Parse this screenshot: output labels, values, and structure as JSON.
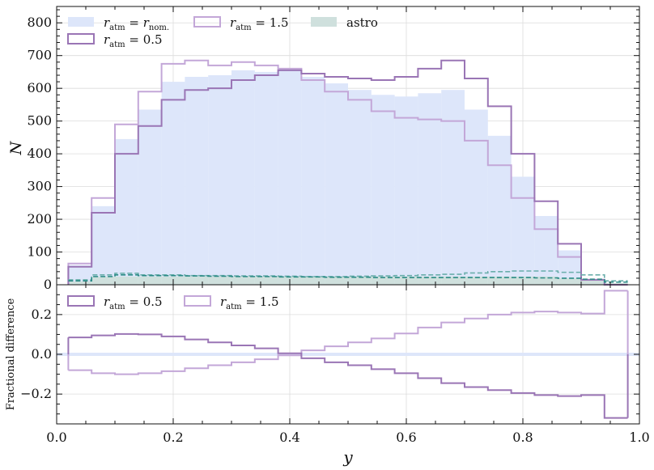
{
  "colors": {
    "nominal_fill": "#dde6fa",
    "r05": "#9a75b5",
    "r15": "#c3a7d8",
    "astro_fill": "#cfe0dd",
    "astro_dash_a": "#6aaeab",
    "astro_dash_b": "#2a8a85",
    "grid": "#dcdcdc"
  },
  "chart_data": [
    {
      "type": "bar",
      "panel": "top",
      "xlim": [
        0.0,
        1.0
      ],
      "ylim": [
        0,
        850
      ],
      "ylabel": "N",
      "xlabel": "",
      "grid": true,
      "legend_placement": "top-left",
      "bin_edges": [
        0.02,
        0.06,
        0.1,
        0.14,
        0.18,
        0.22,
        0.26,
        0.3,
        0.34,
        0.38,
        0.42,
        0.46,
        0.5,
        0.54,
        0.58,
        0.62,
        0.66,
        0.7,
        0.74,
        0.78,
        0.82,
        0.86,
        0.9,
        0.94,
        0.98
      ],
      "y_ticks": [
        "0",
        "100",
        "200",
        "300",
        "400",
        "500",
        "600",
        "700",
        "800"
      ],
      "series": [
        {
          "name": "r_atm = r_nom.",
          "style": "filled",
          "values": [
            60,
            240,
            445,
            535,
            620,
            635,
            640,
            655,
            650,
            660,
            635,
            615,
            595,
            580,
            575,
            585,
            595,
            535,
            455,
            330,
            210,
            105,
            15,
            0
          ]
        },
        {
          "name": "r_atm = 0.5",
          "style": "step",
          "values": [
            55,
            220,
            400,
            485,
            565,
            595,
            600,
            625,
            640,
            655,
            645,
            635,
            630,
            625,
            635,
            660,
            685,
            630,
            545,
            400,
            255,
            125,
            15,
            0
          ]
        },
        {
          "name": "r_atm = 1.5",
          "style": "step",
          "values": [
            65,
            265,
            490,
            590,
            675,
            685,
            670,
            680,
            670,
            660,
            625,
            590,
            565,
            530,
            510,
            505,
            500,
            440,
            365,
            265,
            170,
            85,
            15,
            0
          ]
        },
        {
          "name": "astro",
          "style": "filled",
          "values": [
            10,
            25,
            25,
            25,
            25,
            25,
            25,
            25,
            25,
            25,
            25,
            25,
            25,
            25,
            25,
            25,
            25,
            25,
            25,
            25,
            25,
            20,
            15,
            5
          ]
        },
        {
          "name": "",
          "style": "dashed-a",
          "values": [
            15,
            30,
            35,
            30,
            30,
            28,
            28,
            27,
            27,
            26,
            25,
            25,
            26,
            27,
            28,
            30,
            32,
            36,
            40,
            42,
            42,
            38,
            30,
            12
          ]
        },
        {
          "name": "",
          "style": "dashed-b",
          "values": [
            12,
            25,
            30,
            28,
            28,
            27,
            26,
            25,
            25,
            24,
            24,
            23,
            23,
            22,
            22,
            22,
            22,
            22,
            22,
            22,
            21,
            20,
            17,
            8
          ]
        }
      ],
      "legend": [
        {
          "label": "r_atm = r_nom.",
          "series": 0
        },
        {
          "label": "r_atm = 0.5",
          "series": 1
        },
        {
          "label": "r_atm = 1.5",
          "series": 2
        },
        {
          "label": "astro",
          "series": 3
        }
      ]
    },
    {
      "type": "bar",
      "panel": "bottom",
      "xlim": [
        0.0,
        1.0
      ],
      "ylim": [
        -0.35,
        0.35
      ],
      "ylabel": "Fractional difference",
      "xlabel": "y",
      "grid": true,
      "legend_placement": "top-left",
      "bin_edges": [
        0.02,
        0.06,
        0.1,
        0.14,
        0.18,
        0.22,
        0.26,
        0.3,
        0.34,
        0.38,
        0.42,
        0.46,
        0.5,
        0.54,
        0.58,
        0.62,
        0.66,
        0.7,
        0.74,
        0.78,
        0.82,
        0.86,
        0.9,
        0.94,
        0.98
      ],
      "x_ticks": [
        "0.0",
        "0.2",
        "0.4",
        "0.6",
        "0.8",
        "1.0"
      ],
      "y_ticks": [
        "−0.2",
        "0.0",
        "0.2"
      ],
      "series": [
        {
          "name": "r_atm = 0.5",
          "style": "step",
          "values": [
            0.085,
            0.095,
            0.102,
            0.1,
            0.09,
            0.075,
            0.06,
            0.045,
            0.03,
            0.005,
            -0.02,
            -0.04,
            -0.055,
            -0.075,
            -0.095,
            -0.12,
            -0.145,
            -0.165,
            -0.18,
            -0.195,
            -0.205,
            -0.21,
            -0.205,
            -0.32
          ]
        },
        {
          "name": "r_atm = 1.5",
          "style": "step",
          "values": [
            -0.08,
            -0.095,
            -0.1,
            -0.095,
            -0.085,
            -0.07,
            -0.055,
            -0.04,
            -0.025,
            -0.005,
            0.02,
            0.04,
            0.06,
            0.08,
            0.105,
            0.135,
            0.16,
            0.18,
            0.2,
            0.21,
            0.215,
            0.21,
            0.205,
            0.32
          ]
        }
      ],
      "legend": [
        {
          "label": "r_atm = 0.5",
          "series": 0
        },
        {
          "label": "r_atm = 1.5",
          "series": 1
        }
      ]
    }
  ]
}
